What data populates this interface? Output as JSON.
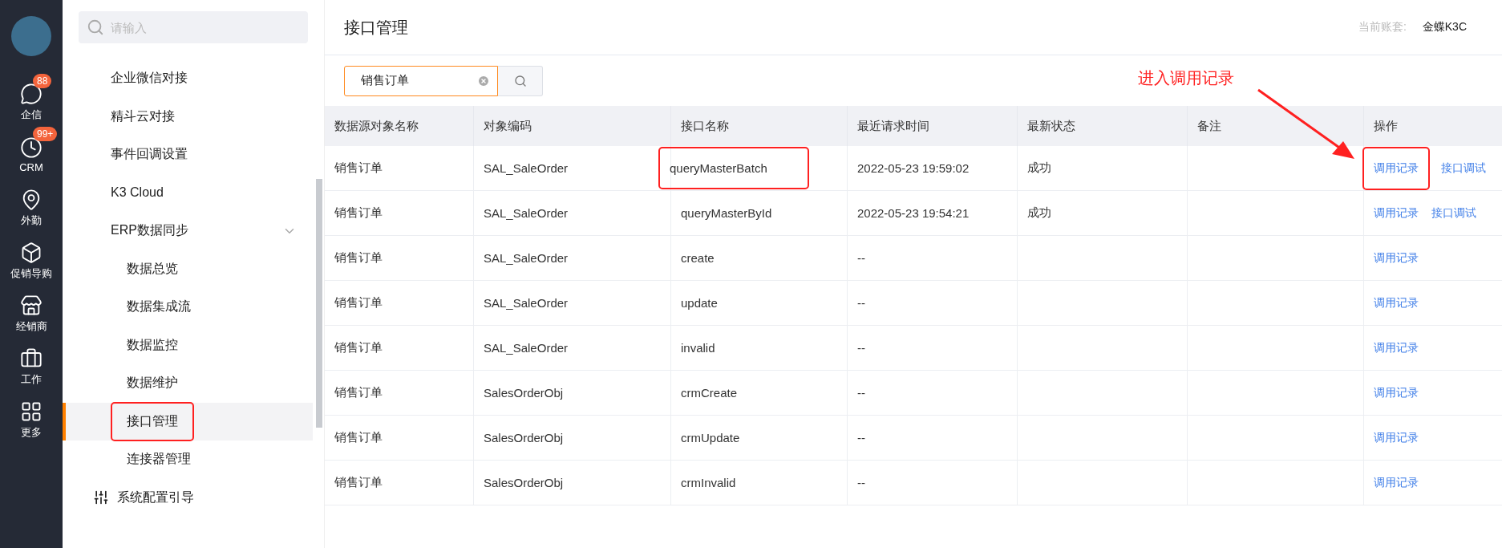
{
  "rail": {
    "items": [
      {
        "label": "企信",
        "kind": "chat",
        "badge": "88"
      },
      {
        "label": "CRM",
        "kind": "clock",
        "badge": "99+"
      },
      {
        "label": "外勤",
        "kind": "pin"
      },
      {
        "label": "促销导购",
        "kind": "box"
      },
      {
        "label": "经销商",
        "kind": "store"
      },
      {
        "label": "工作",
        "kind": "case"
      },
      {
        "label": "更多",
        "kind": "grid"
      }
    ]
  },
  "sidebar": {
    "search": {
      "placeholder": "请输入"
    },
    "items": [
      {
        "label": "企业微信对接",
        "kind": "plain",
        "selected": false,
        "outlined": false
      },
      {
        "label": "精斗云对接",
        "kind": "plain",
        "selected": false,
        "outlined": false
      },
      {
        "label": "事件回调设置",
        "kind": "plain",
        "selected": false,
        "outlined": false
      },
      {
        "label": "K3 Cloud",
        "kind": "plain",
        "selected": false,
        "outlined": false
      },
      {
        "label": "ERP数据同步",
        "kind": "group",
        "expanded": true,
        "selected": false,
        "outlined": false,
        "children": [
          {
            "label": "数据总览",
            "selected": false,
            "outlined": false
          },
          {
            "label": "数据集成流",
            "selected": false,
            "outlined": false
          },
          {
            "label": "数据监控",
            "selected": false,
            "outlined": false
          },
          {
            "label": "数据维护",
            "selected": false,
            "outlined": false
          },
          {
            "label": "接口管理",
            "selected": true,
            "outlined": true
          },
          {
            "label": "连接器管理",
            "selected": false,
            "outlined": false
          }
        ]
      },
      {
        "label": "系统配置引导",
        "kind": "settings",
        "selected": false,
        "outlined": false
      }
    ]
  },
  "header": {
    "title": "接口管理",
    "account_label": "当前账套:",
    "account_value": "金蝶K3C"
  },
  "search": {
    "value": "销售订单"
  },
  "annotation": {
    "text": "进入调用记录"
  },
  "table": {
    "columns": [
      "数据源对象名称",
      "对象编码",
      "接口名称",
      "最近请求时间",
      "最新状态",
      "备注",
      "操作"
    ],
    "rows": [
      {
        "object": "销售订单",
        "code": "SAL_SaleOrder",
        "api": "queryMasterBatch",
        "api_outlined": true,
        "time": "2022-05-23 19:59:02",
        "status": "成功",
        "actions": [
          {
            "label": "调用记录",
            "outlined": true
          },
          {
            "label": "接口调试",
            "outlined": false
          }
        ]
      },
      {
        "object": "销售订单",
        "code": "SAL_SaleOrder",
        "api": "queryMasterById",
        "api_outlined": false,
        "time": "2022-05-23 19:54:21",
        "status": "成功",
        "actions": [
          {
            "label": "调用记录",
            "outlined": false
          },
          {
            "label": "接口调试",
            "outlined": false
          }
        ]
      },
      {
        "object": "销售订单",
        "code": "SAL_SaleOrder",
        "api": "create",
        "api_outlined": false,
        "time": "--",
        "actions": [
          {
            "label": "调用记录",
            "outlined": false
          }
        ]
      },
      {
        "object": "销售订单",
        "code": "SAL_SaleOrder",
        "api": "update",
        "api_outlined": false,
        "time": "--",
        "actions": [
          {
            "label": "调用记录",
            "outlined": false
          }
        ]
      },
      {
        "object": "销售订单",
        "code": "SAL_SaleOrder",
        "api": "invalid",
        "api_outlined": false,
        "time": "--",
        "actions": [
          {
            "label": "调用记录",
            "outlined": false
          }
        ]
      },
      {
        "object": "销售订单",
        "code": "SalesOrderObj",
        "api": "crmCreate",
        "api_outlined": false,
        "time": "--",
        "actions": [
          {
            "label": "调用记录",
            "outlined": false
          }
        ]
      },
      {
        "object": "销售订单",
        "code": "SalesOrderObj",
        "api": "crmUpdate",
        "api_outlined": false,
        "time": "--",
        "actions": [
          {
            "label": "调用记录",
            "outlined": false
          }
        ]
      },
      {
        "object": "销售订单",
        "code": "SalesOrderObj",
        "api": "crmInvalid",
        "api_outlined": false,
        "time": "--",
        "actions": [
          {
            "label": "调用记录",
            "outlined": false
          }
        ]
      }
    ]
  }
}
